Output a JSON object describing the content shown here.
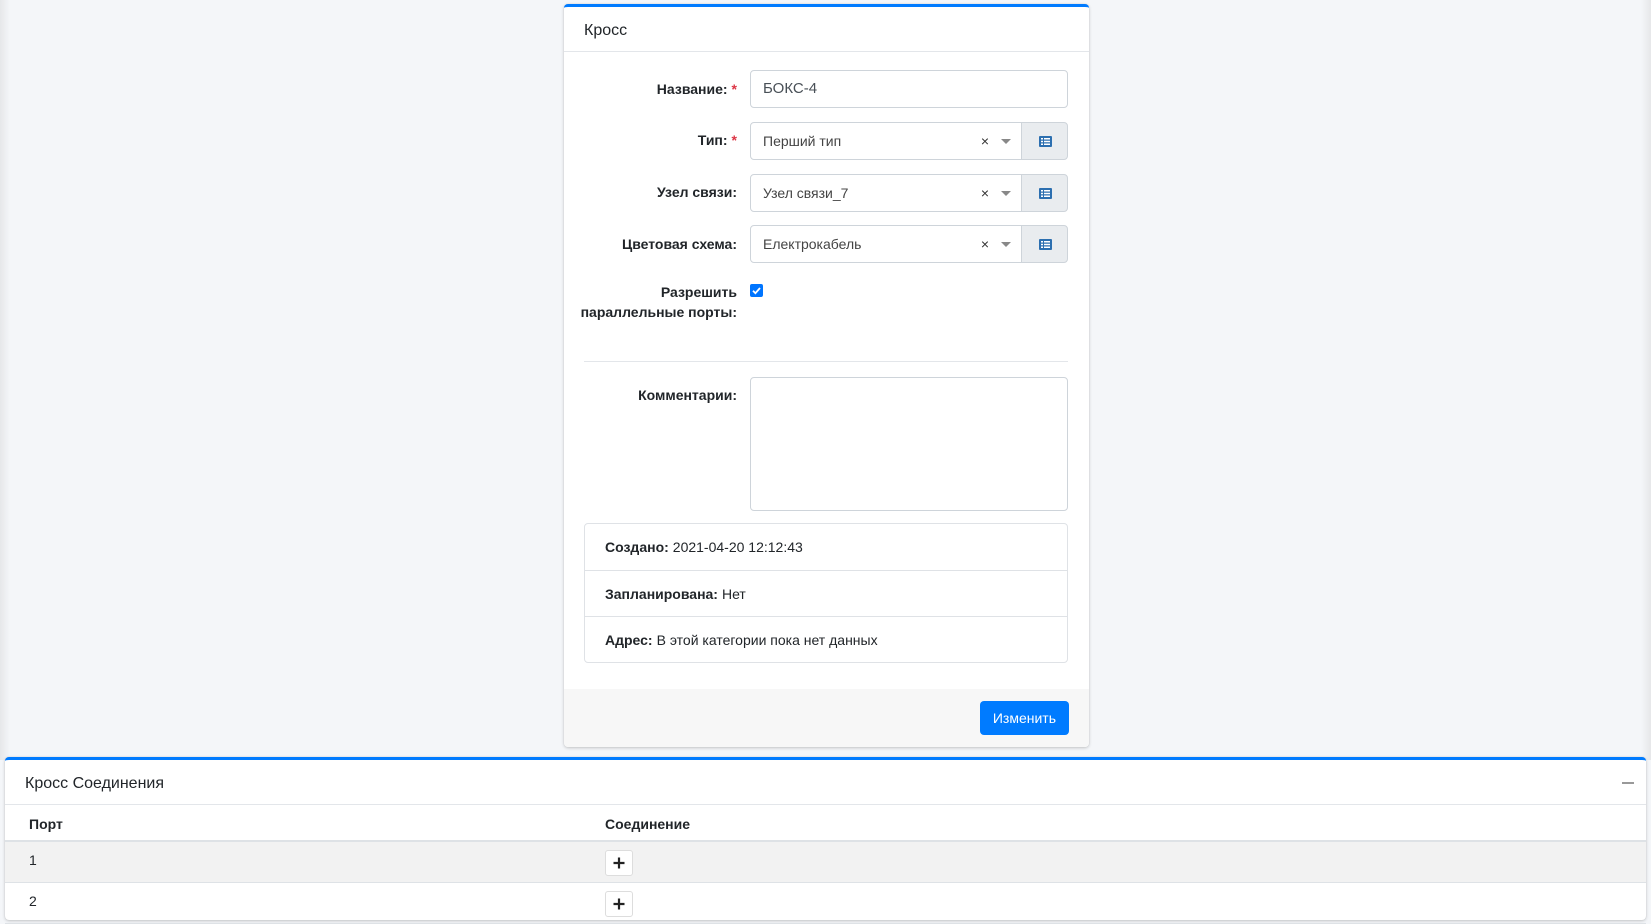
{
  "form": {
    "header_title": "Кросс",
    "name": {
      "label": "Название:",
      "required_mark": "*",
      "value": "БОКС-4"
    },
    "type": {
      "label": "Тип:",
      "required_mark": "*",
      "value": "Перший тип",
      "clear": "×"
    },
    "node": {
      "label": "Узел связи:",
      "value": "Узел связи_7",
      "clear": "×"
    },
    "color_scheme": {
      "label": "Цветовая схема:",
      "value": "Електрокабель",
      "clear": "×"
    },
    "parallel_ports": {
      "label_line1": "Разрешить",
      "label_line2": "параллельные порты:",
      "checked": true
    },
    "comments": {
      "label": "Комментарии:",
      "value": ""
    },
    "info": {
      "created_label": "Создано:",
      "created_value": "2021-04-20 12:12:43",
      "planned_label": "Запланирована:",
      "planned_value": "Нет",
      "address_label": "Адрес:",
      "address_value": "В этой категории пока нет данных"
    },
    "submit_label": "Изменить"
  },
  "cross_connections": {
    "header_title": "Кросс Соединения",
    "columns": [
      "Порт",
      "Соединение"
    ],
    "rows": [
      {
        "port": "1"
      },
      {
        "port": "2"
      }
    ]
  },
  "colors": {
    "accent": "#007bff",
    "background": "#f4f6f9"
  },
  "icons": {
    "select_addon": "list-icon",
    "add": "plus-icon",
    "collapse": "minus-icon"
  }
}
